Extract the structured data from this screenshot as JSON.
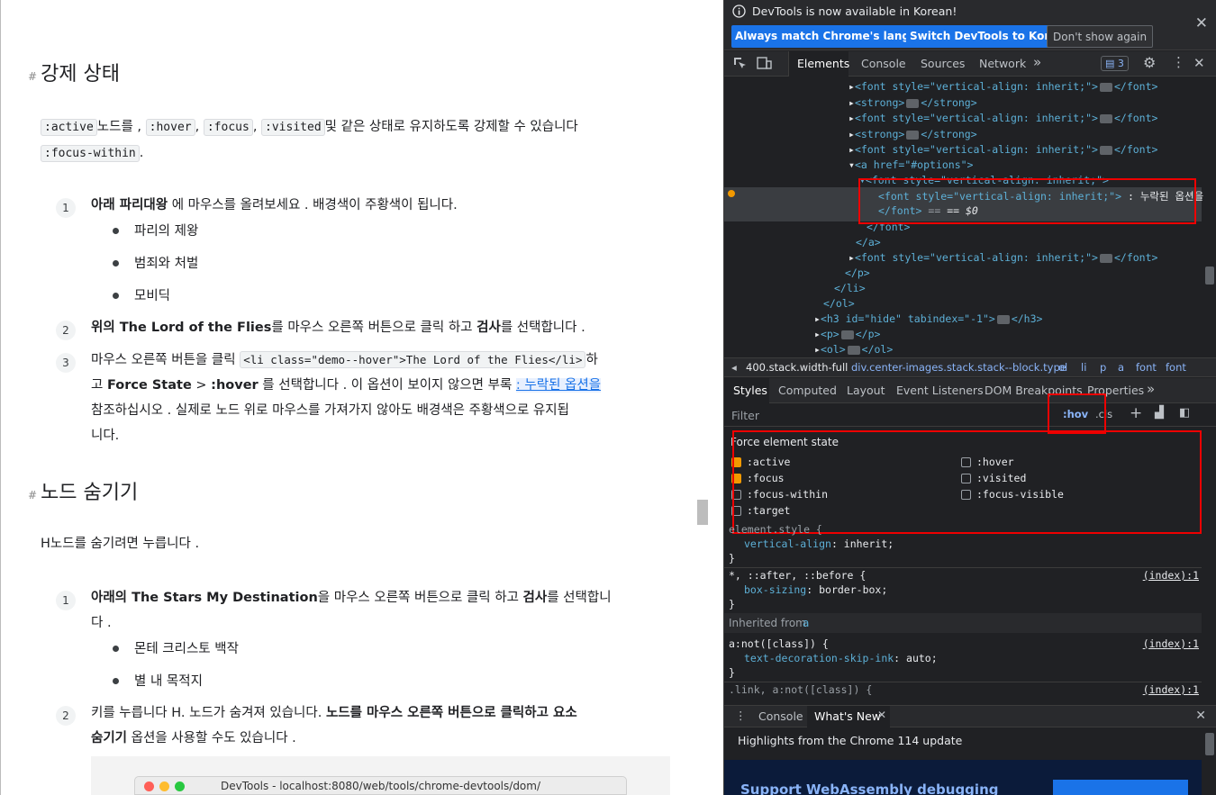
{
  "doc": {
    "h_force": "강제 상태",
    "intro_codes": [
      ":active",
      ":hover",
      ":focus",
      ":visited",
      ":focus-within"
    ],
    "intro_t1": "노드를 ,",
    "intro_t2": ",",
    "intro_t3": ",",
    "intro_t4": "및 같은 상태로 유지하도록 강제할 수 있습니다",
    "intro_t5": ".",
    "step1_num": "1",
    "step1_bold": "아래 파리대왕",
    "step1_rest": " 에 마우스를 올려보세요 . 배경색이 주황색이 됩니다.",
    "bul1": [
      "파리의 제왕",
      "범죄와 처벌",
      "모비딕"
    ],
    "step2_num": "2",
    "step2_b1": "위의 The Lord of the Flies",
    "step2_t1": "를 마우스 오른쪽 버튼으로 클릭 하고 ",
    "step2_b2": "검사",
    "step2_t2": "를 선택합니다 .",
    "step3_num": "3",
    "step3_t1": "마우스 오른쪽 버튼을 클릭 ",
    "step3_code": "<li class=\"demo--hover\">The Lord of the Flies</li>",
    "step3_t2": "하",
    "step3_t3": "고 ",
    "step3_b1": "Force State",
    "step3_t4": " > ",
    "step3_b2": ":hover",
    "step3_t5": " 를 선택합니다 . 이 옵션이 보이지 않으면 부록 ",
    "step3_link": ": 누락된 옵션을",
    "step3_t6": "참조하십시오 . 실제로 노드 위로 마우스를 가져가지 않아도 배경색은 주황색으로 유지됩",
    "step3_t7": "니다.",
    "h_hide": "노드 숨기기",
    "hide_intro": "H노드를 숨기려면 누릅니다 .",
    "hstep1_num": "1",
    "hstep1_b1": "아래의 The Stars My Destination",
    "hstep1_t1": "을 마우스 오른쪽 버튼으로 클릭 하고 ",
    "hstep1_b2": "검사",
    "hstep1_t2": "를 선택합니",
    "hstep1_t3": "다 .",
    "bul2": [
      "몬테 크리스토 백작",
      "별 내 목적지"
    ],
    "hstep2_num": "2",
    "hstep2_t1": "키를 누릅니다 H. 노드가 숨겨져 있습니다. ",
    "hstep2_b1": "노드를 마우스 오른쪽 버튼으로 클릭하고 요소",
    "hstep2_b2": "숨기기",
    "hstep2_t2": " 옵션을 사용할 수도 있습니다 .",
    "shot_title": "DevTools - localhost:8080/web/tools/chrome-devtools/dom/"
  },
  "devtools": {
    "notice": "DevTools is now available in Korean!",
    "btn_match": "Always match Chrome's language",
    "btn_switch": "Switch DevTools to Korean",
    "btn_dont": "Don't show again",
    "tabs": [
      "Elements",
      "Console",
      "Sources",
      "Network"
    ],
    "issues_count": "3",
    "dom_font": "<font style=\"vertical-align: inherit;\">",
    "dom_font_close": "</font>",
    "dom_strong": "<strong>",
    "dom_strong_close": "</strong>",
    "dom_a": "<a href=\"#options\">",
    "dom_selected_text": ": 누락된 옵션을",
    "dom_dollar": "== $0",
    "dom_a_close": "</a>",
    "dom_p_close": "</p>",
    "dom_li_close": "</li>",
    "dom_ol_close": "</ol>",
    "dom_h3": "<h3 id=\"hide\" tabindex=\"-1\">",
    "dom_h3_close": "</h3>",
    "dom_p": "<p>",
    "dom_ol": "<ol>",
    "crumbs": [
      "400.stack.width-full",
      "div.center-images.stack.stack--block.type",
      "ol",
      "li",
      "p",
      "a",
      "font",
      "font"
    ],
    "style_tabs": [
      "Styles",
      "Computed",
      "Layout",
      "Event Listeners",
      "DOM Breakpoints",
      "Properties"
    ],
    "filter_placeholder": "Filter",
    "hov": ":hov",
    "cls": ".cls",
    "force_title": "Force element state",
    "states_left": [
      ":active",
      ":focus",
      ":focus-within",
      ":target"
    ],
    "states_right": [
      ":hover",
      ":visited",
      ":focus-visible"
    ],
    "states_checked": [
      ":active",
      ":focus"
    ],
    "rule1_sel": "element.style {",
    "rule1_prop": "vertical-align",
    "rule1_val": "inherit;",
    "close_brace": "}",
    "rule2_sel": "*, ::after, ::before {",
    "rule2_src": "(index):1",
    "rule2_prop": "box-sizing",
    "rule2_val": "border-box;",
    "inherited": "Inherited from ",
    "inherited_el": "a",
    "rule3_sel": "a:not([class]) {",
    "rule3_src": "(index):1",
    "rule3_prop": "text-decoration-skip-ink",
    "rule3_val": "auto;",
    "rule4_sel": ".link, a:not([class]) {",
    "rule4_src": "(index):1",
    "drawer_tabs": [
      "Console",
      "What's New"
    ],
    "drawer_text": "Highlights from the Chrome 114 update",
    "drawer_card": "Support WebAssembly debugging"
  }
}
